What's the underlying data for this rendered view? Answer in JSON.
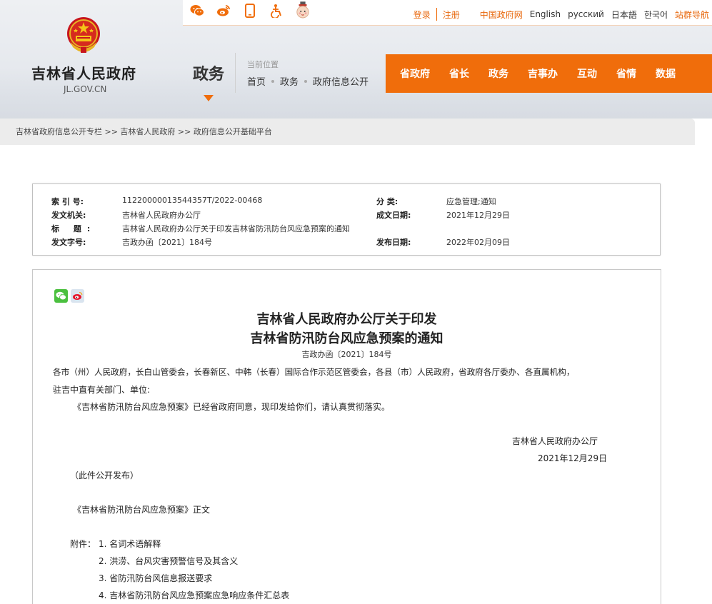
{
  "header": {
    "site_title": "吉林省人民政府",
    "site_domain": "JL.GOV.CN",
    "section_name": "政务",
    "location_label": "当前位置",
    "location_crumbs": [
      "首页",
      "政务",
      "政府信息公开"
    ]
  },
  "topbar": {
    "icons": [
      "wechat-icon",
      "weibo-icon",
      "mobile-icon",
      "accessibility-icon",
      "mascot-icon"
    ],
    "login": "登录",
    "register": "注册",
    "links": [
      {
        "label": "中国政府网",
        "color": "orange"
      },
      {
        "label": "English",
        "color": "dark"
      },
      {
        "label": "русский",
        "color": "dark"
      },
      {
        "label": "日本語",
        "color": "dark"
      },
      {
        "label": "한국어",
        "color": "dark"
      },
      {
        "label": "站群导航",
        "color": "orange"
      }
    ]
  },
  "mainnav": [
    "省政府",
    "省长",
    "政务",
    "吉事办",
    "互动",
    "省情",
    "数据"
  ],
  "breadcrumb": "吉林省政府信息公开专栏 >> 吉林省人民政府 >> 政府信息公开基础平台",
  "info": {
    "index_label": "索 引 号:",
    "index_value": "11220000013544357T/2022-00468",
    "category_label": "分 类:",
    "category_value": "应急管理;通知",
    "issuer_label": "发文机关:",
    "issuer_value": "吉林省人民政府办公厅",
    "date_written_label": "成文日期:",
    "date_written_value": "2021年12月29日",
    "title_label": "标 题:",
    "title_value": "吉林省人民政府办公厅关于印发吉林省防汛防台风应急预案的通知",
    "doc_no_label": "发文字号:",
    "doc_no_value": "吉政办函〔2021〕184号",
    "publish_date_label": "发布日期:",
    "publish_date_value": "2022年02月09日"
  },
  "document": {
    "title_line1": "吉林省人民政府办公厅关于印发",
    "title_line2": "吉林省防汛防台风应急预案的通知",
    "doc_no": "吉政办函〔2021〕184号",
    "recipients_line1": "各市（州）人民政府，长白山管委会，长春新区、中韩（长春）国际合作示范区管委会，各县（市）人民政府，省政府各厅委办、各直属机构，",
    "recipients_line2": "驻吉中直有关部门、单位:",
    "body": "《吉林省防汛防台风应急预案》已经省政府同意，现印发给你们，请认真贯彻落实。",
    "signature": "吉林省人民政府办公厅",
    "sign_date": "2021年12月29日",
    "public_note": "（此件公开发布）",
    "text_title": "《吉林省防汛防台风应急预案》正文",
    "attachments_label": "附件：",
    "attachments": [
      "1.  名词术语解释",
      "2.  洪涝、台风灾害预警信号及其含义",
      "3.  省防汛防台风信息报送要求",
      "4.  吉林省防汛防台风应急预案应急响应条件汇总表"
    ]
  },
  "colors": {
    "accent": "#f06d0b",
    "link_orange": "#e8680d",
    "wechat": "#4bc03f",
    "weibo": "#e6162d"
  }
}
